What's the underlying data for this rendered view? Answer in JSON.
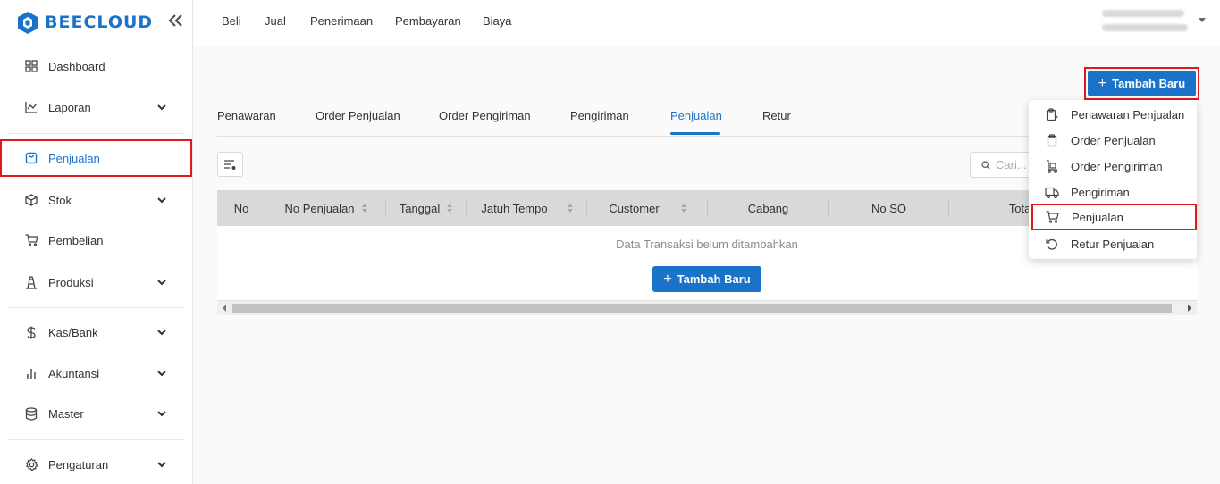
{
  "brand": {
    "name": "BEECLOUD",
    "color": "#1a73c9",
    "collapse_icon": "double-chevron-left-icon"
  },
  "sidebar": {
    "items": [
      {
        "label": "Dashboard",
        "icon": "dashboard-grid-icon",
        "expandable": false
      },
      {
        "label": "Laporan",
        "icon": "line-chart-icon",
        "expandable": true
      },
      {
        "label": "Penjualan",
        "icon": "bag-icon",
        "expandable": false,
        "active": true
      },
      {
        "label": "Stok",
        "icon": "box-icon",
        "expandable": true
      },
      {
        "label": "Pembelian",
        "icon": "cart-icon",
        "expandable": false
      },
      {
        "label": "Produksi",
        "icon": "factory-icon",
        "expandable": true
      },
      {
        "label": "Kas/Bank",
        "icon": "dollar-icon",
        "expandable": true
      },
      {
        "label": "Akuntansi",
        "icon": "bar-chart-icon",
        "expandable": true
      },
      {
        "label": "Master",
        "icon": "database-icon",
        "expandable": true
      },
      {
        "label": "Pengaturan",
        "icon": "gear-icon",
        "expandable": true
      }
    ]
  },
  "topnav": {
    "links": [
      "Beli",
      "Jual",
      "Penerimaan",
      "Pembayaran",
      "Biaya"
    ]
  },
  "actions": {
    "add_new_label": "Tambah Baru",
    "add_icon": "plus-icon"
  },
  "tabs": {
    "items": [
      "Penawaran",
      "Order Penjualan",
      "Order Pengiriman",
      "Pengiriman",
      "Penjualan",
      "Retur"
    ],
    "active": "Penjualan"
  },
  "search": {
    "placeholder": "Cari..."
  },
  "table": {
    "columns": [
      "No",
      "No Penjualan",
      "Tanggal",
      "Jatuh Tempo",
      "Customer",
      "Cabang",
      "No SO",
      "Total"
    ],
    "empty_text": "Data Transaksi belum ditambahkan",
    "add_label": "Tambah Baru"
  },
  "dropdown": {
    "items": [
      {
        "label": "Penawaran Penjualan",
        "icon": "clipboard-plus-icon"
      },
      {
        "label": "Order Penjualan",
        "icon": "clipboard-icon"
      },
      {
        "label": "Order Pengiriman",
        "icon": "hand-truck-icon"
      },
      {
        "label": "Pengiriman",
        "icon": "truck-icon"
      },
      {
        "label": "Penjualan",
        "icon": "cart-icon",
        "highlighted": true
      },
      {
        "label": "Retur Penjualan",
        "icon": "undo-icon"
      }
    ]
  },
  "colors": {
    "accent": "#1a73c9",
    "highlight_border": "#e0191f",
    "table_header": "#d9d9d9"
  }
}
